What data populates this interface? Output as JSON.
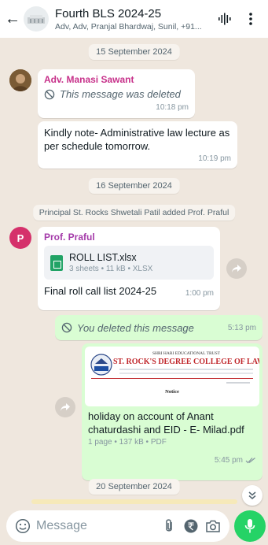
{
  "header": {
    "title": "Fourth BLS 2024-25",
    "subtitle": "Adv, Adv, Pranjal Bhardwaj, Sunil, +91..."
  },
  "dates": {
    "d1": "15 September 2024",
    "d2": "16 September 2024",
    "d3": "20 September 2024"
  },
  "messages": {
    "m1": {
      "sender": "Adv. Manasi Sawant",
      "deleted_text": "This message was deleted",
      "time": "10:18 pm"
    },
    "m2": {
      "text": "Kindly note- Administrative law lecture as per schedule tomorrow.",
      "time": "10:19 pm"
    },
    "system": "Principal St. Rocks Shwetali Patil added Prof. Praful",
    "m3": {
      "avatar_letter": "P",
      "sender": "Prof. Praful",
      "file_name": "ROLL LIST.xlsx",
      "file_meta": "3 sheets • 11 kB • XLSX",
      "caption": "Final roll call list 2024-25",
      "time": "1:00 pm"
    },
    "m4": {
      "deleted_text": "You deleted this message",
      "time": "5:13 pm"
    },
    "m5": {
      "preview_trust": "SHRI HARI EDUCATIONAL TRUST",
      "preview_college": "ST. ROCK'S DEGREE COLLEGE OF LAW",
      "preview_notice": "Notice",
      "file_name": "holiday on account of Anant chaturdashi and EID - E- Milad.pdf",
      "file_meta": "1 page • 137 kB • PDF",
      "time": "5:45 pm"
    }
  },
  "composer": {
    "placeholder": "Message"
  },
  "colors": {
    "accent": "#25d366",
    "outgoing": "#d9fdd3",
    "sender_pink": "#c7318a",
    "avatar_p": "#d5316b"
  }
}
